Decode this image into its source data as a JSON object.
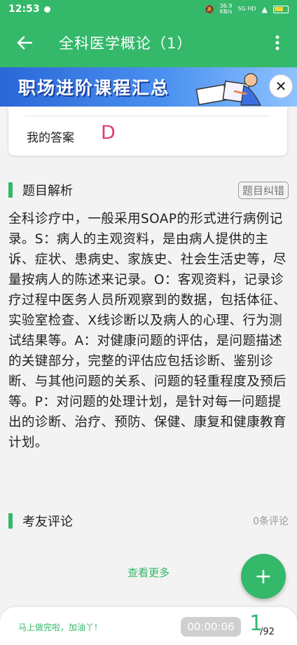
{
  "status_bar": {
    "time": "12:53",
    "net_speed": "36.9",
    "net_unit": "KB/s",
    "network": "5G HD"
  },
  "app_bar": {
    "title": "全科医学概论（1）",
    "back_icon": "back-arrow-icon",
    "menu_icon": "more-vert-icon"
  },
  "banner": {
    "text": "职场进阶课程汇总",
    "close_icon": "close-icon"
  },
  "answer": {
    "label": "我的答案",
    "value": "D"
  },
  "analysis": {
    "title": "题目解析",
    "correct_button": "题目纠错",
    "text": "全科诊疗中，一般采用SOAP的形式进行病例记录。S：病人的主观资料，是由病人提供的主诉、症状、患病史、家族史、社会生活史等，尽量按病人的陈述来记录。O：客观资料，记录诊疗过程中医务人员所观察到的数据，包括体征、实验室检查、X线诊断以及病人的心理、行为测试结果等。A：对健康问题的评估，是问题描述的关键部分，完整的评估应包括诊断、鉴别诊断、与其他问题的关系、问题的轻重程度及预后等。P：对问题的处理计划，是针对每一问题提出的诊断、治疗、预防、保健、康复和健康教育计划。"
  },
  "comments": {
    "title": "考友评论",
    "count": "0条评论",
    "see_more": "查看更多"
  },
  "fab": {
    "icon": "plus-icon",
    "label": "+"
  },
  "bottom_bar": {
    "encouragement": "马上做完啦，加油丫！",
    "timer": "00:00:06",
    "current": "1",
    "total": "/92"
  },
  "colors": {
    "primary": "#34b86a",
    "answer": "#e0397a",
    "banner": "#2a67d8"
  }
}
